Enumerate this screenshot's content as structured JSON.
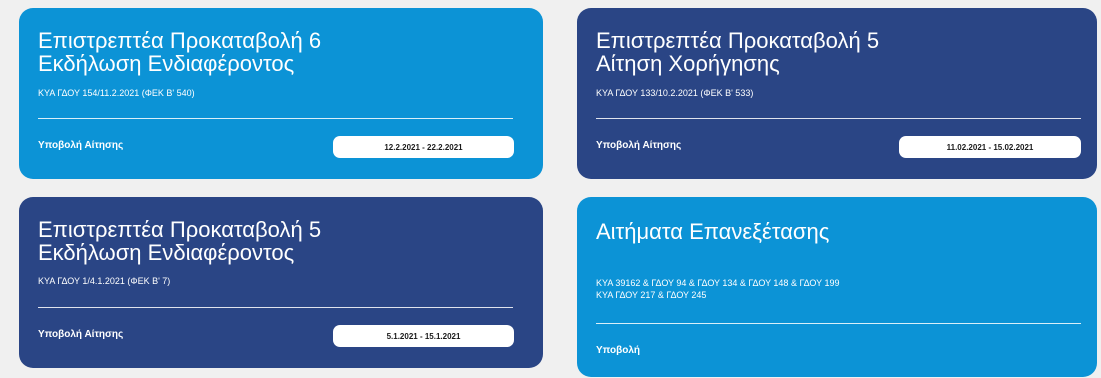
{
  "cards": [
    {
      "title_line1": "Επιστρεπτέα Προκαταβολή 6",
      "title_line2": "Εκδήλωση Ενδιαφέροντος",
      "subtitle": "ΚΥΑ ΓΔΟΥ 154/11.2.2021 (ΦΕΚ Β' 540)",
      "action": "Υποβολή Αίτησης",
      "dates": "12.2.2021 - 22.2.2021"
    },
    {
      "title_line1": "Επιστρεπτέα Προκαταβολή 5",
      "title_line2": "Αίτηση Χορήγησης",
      "subtitle": "ΚΥΑ ΓΔΟΥ 133/10.2.2021 (ΦΕΚ Β' 533)",
      "action": "Υποβολή Αίτησης",
      "dates": "11.02.2021 - 15.02.2021"
    },
    {
      "title_line1": "Επιστρεπτέα Προκαταβολή 5",
      "title_line2": "Εκδήλωση Ενδιαφέροντος",
      "subtitle": "ΚΥΑ ΓΔΟΥ 1/4.1.2021 (ΦΕΚ Β' 7)",
      "action": "Υποβολή Αίτησης",
      "dates": "5.1.2021 - 15.1.2021"
    },
    {
      "title_line1": "Αιτήματα Επανεξέτασης",
      "subtitle_line1": "ΚΥΑ 39162 & ΓΔΟΥ 94 & ΓΔΟΥ 134 & ΓΔΟΥ 148 & ΓΔΟΥ 199",
      "subtitle_line2": "ΚΥΑ ΓΔΟΥ 217 & ΓΔΟΥ 245",
      "action": "Υποβολή"
    }
  ],
  "colors": {
    "light_card": "#0c93d6",
    "dark_card": "#2a4585",
    "background": "#f0f0f0"
  }
}
